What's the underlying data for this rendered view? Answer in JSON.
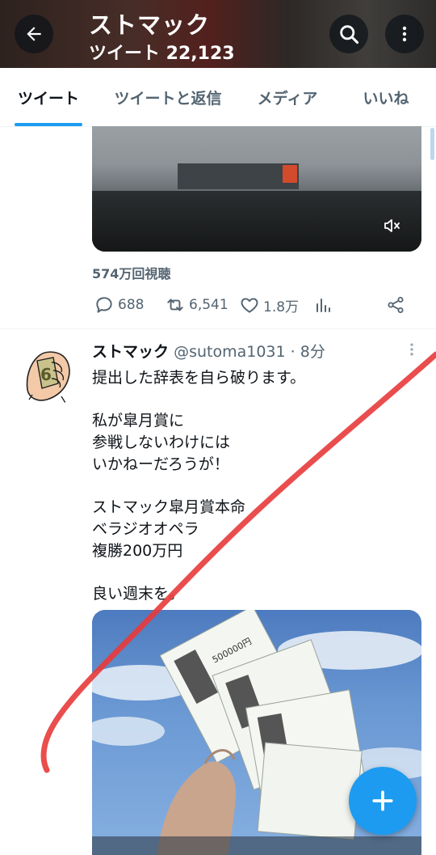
{
  "header": {
    "title": "ストマック",
    "tweet_count": "ツイート 22,123",
    "back_icon": "arrow-left-icon",
    "search_icon": "search-icon",
    "more_icon": "more-vertical-icon"
  },
  "tabs": [
    {
      "label": "ツイート",
      "active": true
    },
    {
      "label": "ツイートと返信",
      "active": false
    },
    {
      "label": "メディア",
      "active": false
    },
    {
      "label": "いいね",
      "active": false
    }
  ],
  "prev_tweet": {
    "views": "574万回視聴",
    "mute_icon": "volume-mute-icon",
    "actions": {
      "reply": "688",
      "retweet": "6,541",
      "like": "1.8万"
    }
  },
  "tweet": {
    "name": "ストマック",
    "handle": "@sutoma1031",
    "dot": "·",
    "time": "8分",
    "lines": [
      "提出した辞表を自ら破ります。",
      "",
      "私が皐月賞に",
      "参戦しないわけには",
      "いかねーだろうが！",
      "",
      "ストマック皐月賞本命",
      "ベラジオオペラ",
      "複勝200万円",
      "",
      "良い週末を。"
    ]
  },
  "photo": {
    "ticket_text": "500000円"
  },
  "colors": {
    "accent": "#1d9bf0",
    "text_primary": "#0f1419",
    "text_secondary": "#536471",
    "annotation_stroke": "#e83a3a"
  }
}
